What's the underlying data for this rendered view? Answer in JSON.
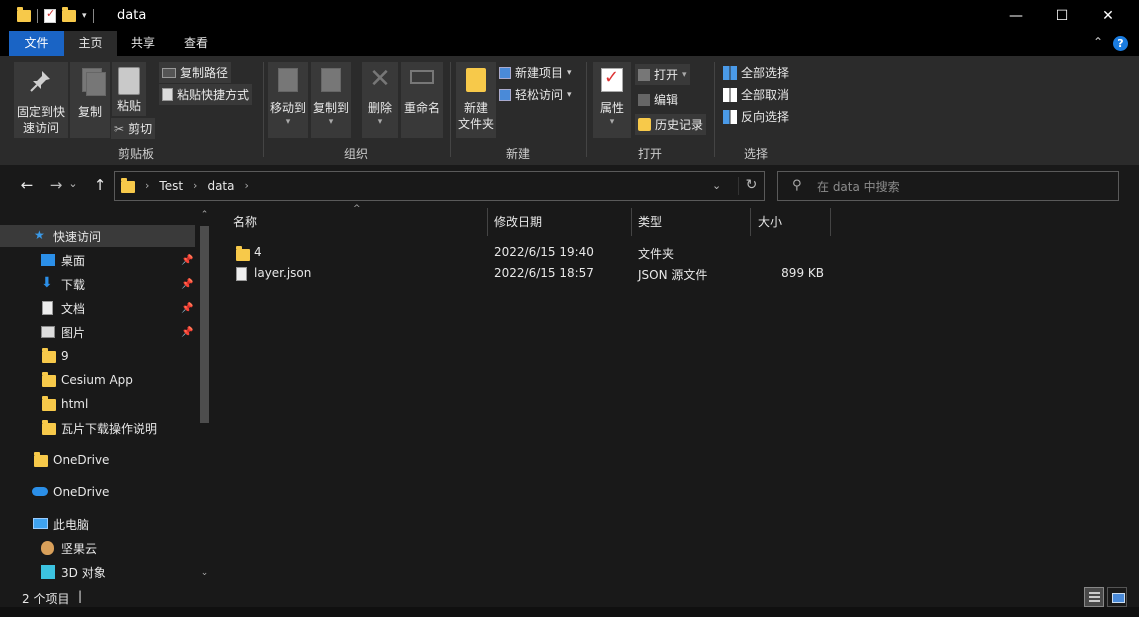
{
  "window": {
    "title": "data",
    "minimize_glyph": "—",
    "maximize_glyph": "☐",
    "close_glyph": "✕"
  },
  "ribbon_tabs": {
    "file": "文件",
    "home": "主页",
    "share": "共享",
    "view": "查看"
  },
  "ribbon_controls": {
    "collapse_glyph": "⌃",
    "help_glyph": "?"
  },
  "ribbon": {
    "clipboard": {
      "pin_label": "固定到快\n速访问",
      "copy_label": "复制",
      "paste_label": "粘贴",
      "cut_label": "剪切",
      "copy_path_label": "复制路径",
      "paste_shortcut_label": "粘贴快捷方式",
      "group_label": "剪贴板"
    },
    "organize": {
      "move_to_label": "移动到",
      "copy_to_label": "复制到",
      "delete_label": "删除",
      "rename_label": "重命名",
      "group_label": "组织"
    },
    "new": {
      "new_folder_label": "新建\n文件夹",
      "new_item_label": "新建项目",
      "easy_access_label": "轻松访问",
      "group_label": "新建"
    },
    "open": {
      "properties_label": "属性",
      "open_label": "打开",
      "edit_label": "编辑",
      "history_label": "历史记录",
      "group_label": "打开"
    },
    "select": {
      "select_all_label": "全部选择",
      "select_none_label": "全部取消",
      "invert_label": "反向选择",
      "group_label": "选择"
    }
  },
  "address_bar": {
    "crumbs": [
      "Test",
      "data"
    ],
    "back_glyph": "←",
    "forward_glyph": "→",
    "recent_glyph": "⌄",
    "up_glyph": "↑",
    "dropdown_glyph": "⌄",
    "refresh_glyph": "↻"
  },
  "search": {
    "placeholder": "在 data 中搜索"
  },
  "nav_pane": {
    "quick_access": "快速访问",
    "items": [
      {
        "label": "桌面",
        "icon": "desktop-icon",
        "pinned": true
      },
      {
        "label": "下载",
        "icon": "download-icon",
        "pinned": true
      },
      {
        "label": "文档",
        "icon": "document-icon",
        "pinned": true
      },
      {
        "label": "图片",
        "icon": "pictures-icon",
        "pinned": true
      },
      {
        "label": "9",
        "icon": "folder-icon",
        "pinned": false
      },
      {
        "label": "Cesium App",
        "icon": "folder-icon",
        "pinned": false
      },
      {
        "label": "html",
        "icon": "folder-icon",
        "pinned": false
      },
      {
        "label": "瓦片下载操作说明",
        "icon": "folder-icon",
        "pinned": false
      }
    ],
    "onedrive_personal": "OneDrive",
    "onedrive_cloud": "OneDrive",
    "this_pc": "此电脑",
    "jianguoyun": "坚果云",
    "objects_3d": "3D 对象"
  },
  "file_list": {
    "columns": {
      "name": "名称",
      "modified": "修改日期",
      "type": "类型",
      "size": "大小"
    },
    "rows": [
      {
        "name": "4",
        "modified": "2022/6/15 19:40",
        "type": "文件夹",
        "size": "",
        "icon": "folder-icon"
      },
      {
        "name": "layer.json",
        "modified": "2022/6/15 18:57",
        "type": "JSON 源文件",
        "size": "899 KB",
        "icon": "json-file-icon"
      }
    ]
  },
  "status": {
    "item_count": "2 个项目",
    "cursor": "|"
  },
  "colors": {
    "file_tab": "#1a64c5",
    "folder": "#f7c94a",
    "background": "#191919",
    "ribbon": "#2b2b2b"
  }
}
